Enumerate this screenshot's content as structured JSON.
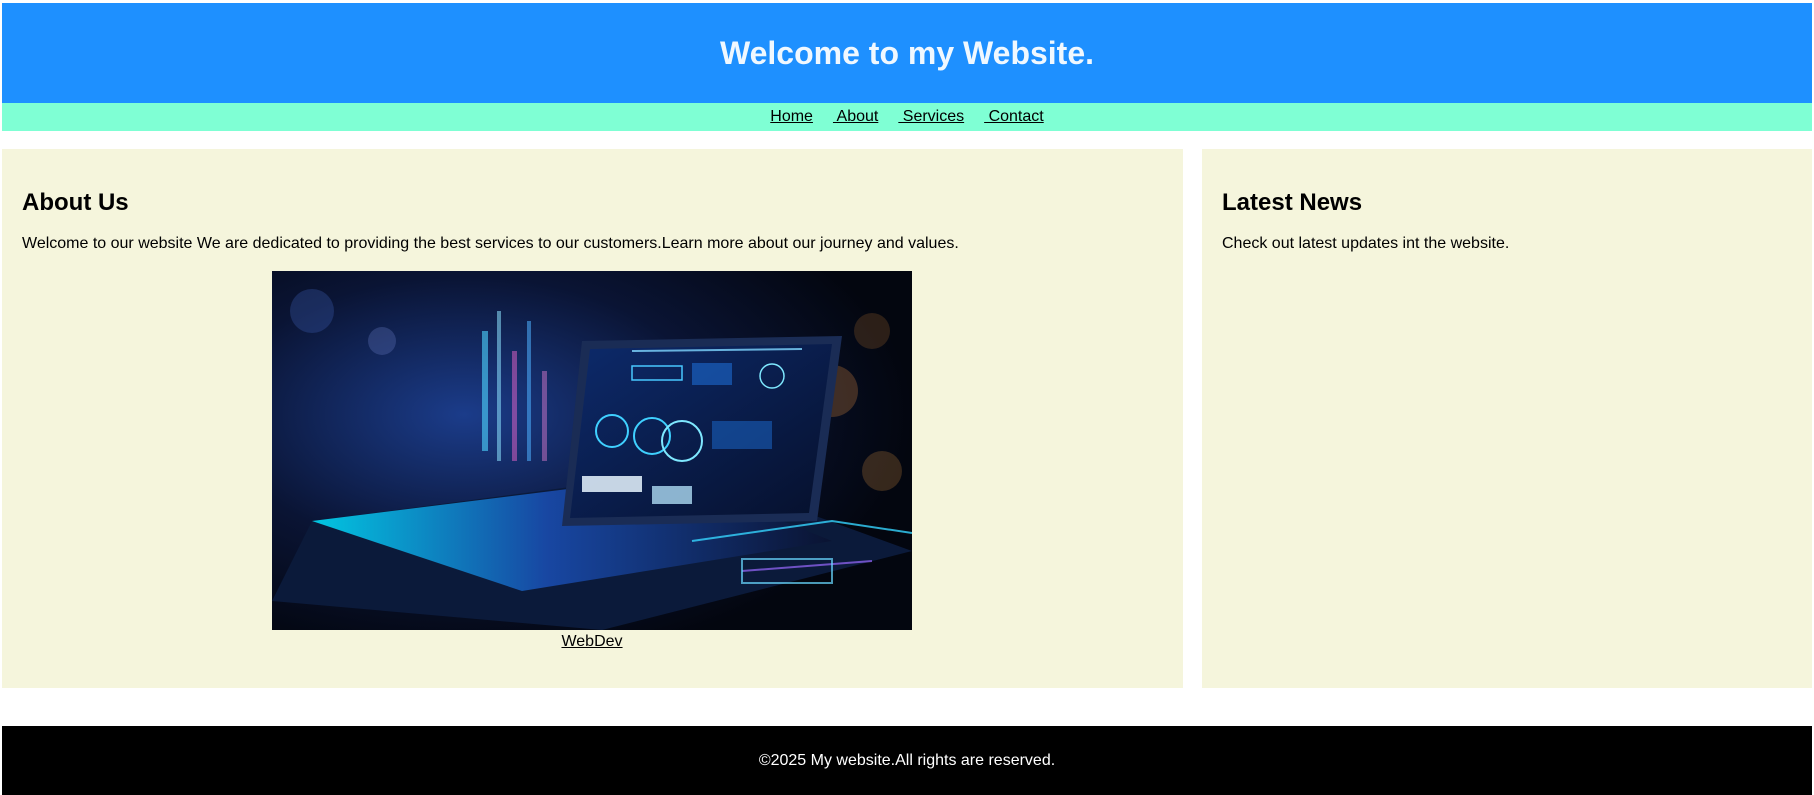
{
  "header": {
    "title": "Welcome to my Website."
  },
  "nav": {
    "items": [
      {
        "label": "Home"
      },
      {
        "label": " About"
      },
      {
        "label": " Services"
      },
      {
        "label": " Contact"
      }
    ]
  },
  "about": {
    "heading": "About Us",
    "text": "Welcome to our website We are dedicated to providing the best services to our customers.Learn more about our journey and values.",
    "image_link": "WebDev"
  },
  "news": {
    "heading": "Latest News",
    "text": "Check out latest updates int the website."
  },
  "footer": {
    "text": "©2025 My website.All rights are reserved."
  },
  "colors": {
    "header_bg": "#1e90ff",
    "header_text": "#f0f8ff",
    "nav_bg": "#7fffd4",
    "box_bg": "#f5f5dc",
    "footer_bg": "#000000",
    "footer_text": "#ffffff"
  }
}
